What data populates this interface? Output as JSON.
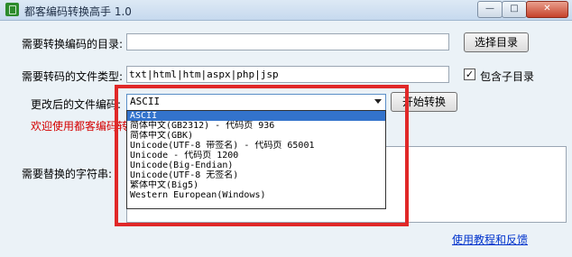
{
  "window": {
    "title": "都客编码转换高手 1.0",
    "minimize_glyph": "—",
    "maximize_glyph": "□",
    "close_glyph": "✕"
  },
  "form": {
    "dir_label": "需要转换编码的目录:",
    "dir_value": "",
    "choose_dir_button": "选择目录",
    "filetype_label": "需要转码的文件类型:",
    "filetype_value": "txt|html|htm|aspx|php|jsp",
    "include_subdirs_label": "包含子目录",
    "include_subdirs_checked": "✓",
    "encoding_label": "更改后的文件编码:",
    "encoding_selected": "ASCII",
    "start_button": "开始转换",
    "welcome_text": "欢迎使用都客编码转",
    "replace_label": "需要替换的字符串:",
    "help_link": "使用教程和反馈"
  },
  "encoding_options": [
    "ASCII",
    "简体中文(GB2312) - 代码页 936",
    "简体中文(GBK)",
    "Unicode(UTF-8 带签名) - 代码页 65001",
    "Unicode - 代码页 1200",
    "Unicode(Big-Endian)",
    "Unicode(UTF-8 无签名)",
    "繁体中文(Big5)",
    "Western European(Windows)"
  ],
  "colors": {
    "highlight_box": "#e02828",
    "selected_option": "#3373cc",
    "welcome_text": "#d40000",
    "link": "#0033cc"
  }
}
